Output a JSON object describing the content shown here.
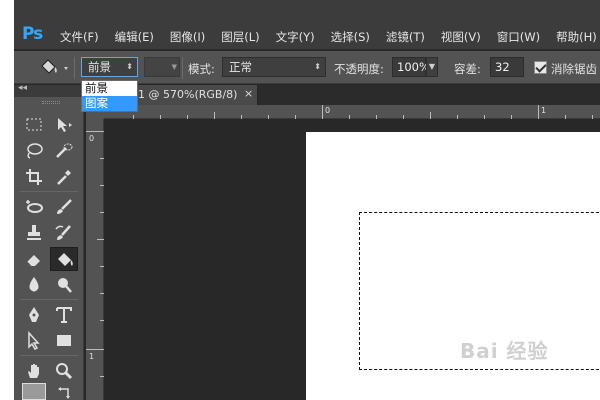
{
  "app": {
    "logo": "Ps"
  },
  "menu": [
    "文件(F)",
    "编辑(E)",
    "图像(I)",
    "图层(L)",
    "文字(Y)",
    "选择(S)",
    "滤镜(T)",
    "视图(V)",
    "窗口(W)",
    "帮助(H)"
  ],
  "options": {
    "fill_source": "前景",
    "mode_label": "模式:",
    "mode_value": "正常",
    "opacity_label": "不透明度:",
    "opacity_value": "100%",
    "tolerance_label": "容差:",
    "tolerance_value": "32",
    "antialias_label": "消除锯齿",
    "antialias_checked": true
  },
  "dropdown": {
    "items": [
      "前景",
      "图案"
    ],
    "selected": "图案"
  },
  "document": {
    "tab_title": "1 @ 570%(RGB/8)",
    "close": "×"
  },
  "ruler": {
    "top_labels": [
      "0",
      "1"
    ],
    "left_labels": [
      "0",
      "1"
    ]
  },
  "watermark": "Bai 经验",
  "colors": {
    "ps_blue": "#31a8ff",
    "menubar": "#3c3c3c",
    "panel": "#535353",
    "workspace": "#282828",
    "dropdown_highlight": "#3399ff"
  }
}
